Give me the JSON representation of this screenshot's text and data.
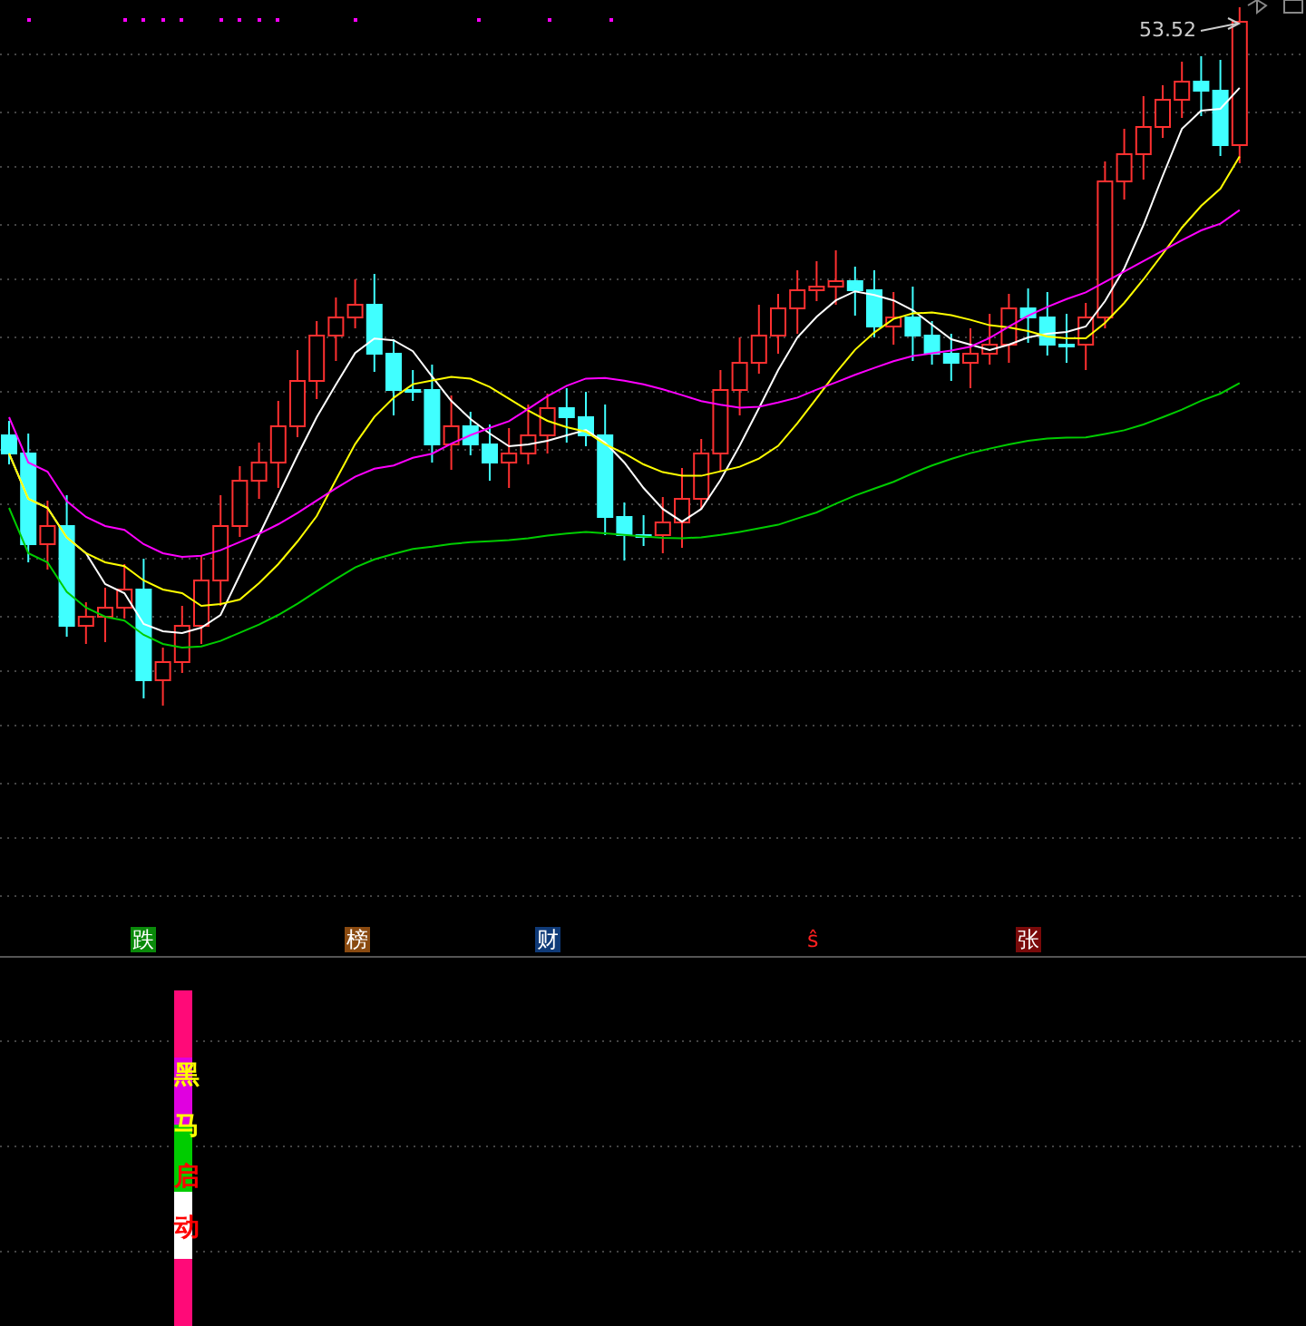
{
  "price_chart": {
    "high_label": "53.52"
  },
  "signals": [
    {
      "label": "跌",
      "color": "#0a8a0a"
    },
    {
      "label": "榜",
      "color": "#8a4a10"
    },
    {
      "label": "财",
      "color": "#0f3a78"
    },
    {
      "label": "ŝ",
      "color": "#000000"
    },
    {
      "label": "张",
      "color": "#7a0a0a"
    }
  ],
  "indicator_bar": {
    "segments": [
      {
        "color": "#ff0a78"
      },
      {
        "color": "#e000e0"
      },
      {
        "color": "#00cc00"
      },
      {
        "color": "#ffffff"
      },
      {
        "color": "#ff0a78"
      }
    ],
    "labels": [
      {
        "text": "黑",
        "kind": "highlight"
      },
      {
        "text": "马",
        "kind": "highlight"
      },
      {
        "text": "启",
        "kind": "alert"
      },
      {
        "text": "动",
        "kind": "alert"
      }
    ]
  }
}
